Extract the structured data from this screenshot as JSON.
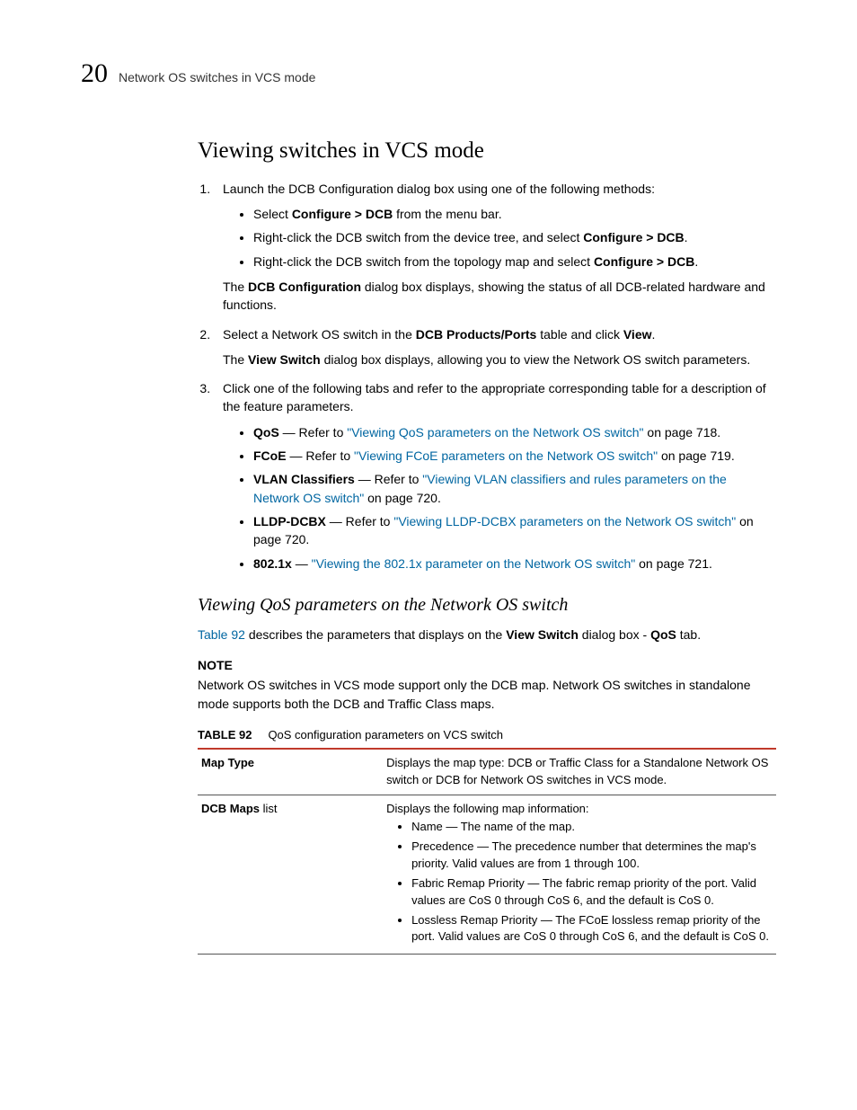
{
  "header": {
    "chapter_number": "20",
    "chapter_title": "Network OS switches in VCS mode"
  },
  "section": {
    "title": "Viewing switches in VCS mode",
    "step1": {
      "text_before": "Launch the DCB Configuration dialog box using one of the following methods:",
      "bullet1_a": "Select ",
      "bullet1_b": "Configure > DCB",
      "bullet1_c": " from the menu bar.",
      "bullet2_a": "Right-click the DCB switch from the device tree, and select ",
      "bullet2_b": "Configure > DCB",
      "bullet2_c": ".",
      "bullet3_a": "Right-click the DCB switch from the topology map and select ",
      "bullet3_b": "Configure > DCB",
      "bullet3_c": ".",
      "note_a": "The ",
      "note_b": "DCB Configuration",
      "note_c": " dialog box displays, showing the status of all DCB-related hardware and functions."
    },
    "step2": {
      "text_a": "Select a Network OS switch in the ",
      "text_b": "DCB Products/Ports",
      "text_c": " table and click ",
      "text_d": "View",
      "text_e": ".",
      "note_a": "The ",
      "note_b": "View Switch",
      "note_c": " dialog box displays, allowing you to view the Network OS switch parameters."
    },
    "step3": {
      "text": "Click one of the following tabs and refer to the appropriate corresponding table for a description of the feature parameters.",
      "b1_label": "QoS",
      "b1_sep": " — Refer to ",
      "b1_link": "\"Viewing QoS parameters on the Network OS switch\"",
      "b1_after": " on page 718.",
      "b2_label": "FCoE",
      "b2_sep": " — Refer to ",
      "b2_link": "\"Viewing FCoE parameters on the Network OS switch\"",
      "b2_after": " on page 719.",
      "b3_label": "VLAN Classifiers",
      "b3_sep": " — Refer to ",
      "b3_link": "\"Viewing VLAN classifiers and rules parameters on the Network OS switch\"",
      "b3_after": " on page 720.",
      "b4_label": "LLDP-DCBX",
      "b4_sep": " — Refer to ",
      "b4_link": "\"Viewing LLDP-DCBX parameters on the Network OS switch\"",
      "b4_after": " on page 720.",
      "b5_label": "802.1x",
      "b5_sep": " — ",
      "b5_link": "\"Viewing the 802.1x parameter on the Network OS switch\"",
      "b5_after": " on page 721."
    }
  },
  "subsection": {
    "title": "Viewing QoS parameters on the Network OS switch",
    "intro_link": "Table 92",
    "intro_a": " describes the parameters that displays on the ",
    "intro_b": "View Switch",
    "intro_c": " dialog box - ",
    "intro_d": "QoS",
    "intro_e": " tab.",
    "note_label": "NOTE",
    "note_text": "Network OS switches in VCS mode support only the DCB map. Network OS switches in standalone mode supports both the DCB and Traffic Class maps."
  },
  "table": {
    "label": "TABLE 92",
    "caption": "QoS configuration parameters on VCS switch",
    "row1": {
      "param": "Map Type",
      "desc": "Displays the map type: DCB or Traffic Class for a Standalone Network OS switch or DCB for Network OS switches in VCS mode."
    },
    "row2": {
      "param_a": "DCB Maps",
      "param_b": " list",
      "desc_intro": "Displays the following map information:",
      "li1": "Name — The name of the map.",
      "li2": "Precedence — The precedence number that determines the map's priority. Valid values are from 1 through 100.",
      "li3": "Fabric Remap Priority — The fabric remap priority of the port. Valid values are CoS 0 through CoS 6, and the default is CoS 0.",
      "li4": "Lossless Remap Priority — The FCoE lossless remap priority of the port. Valid values are CoS 0 through CoS 6, and the default is CoS 0."
    }
  }
}
